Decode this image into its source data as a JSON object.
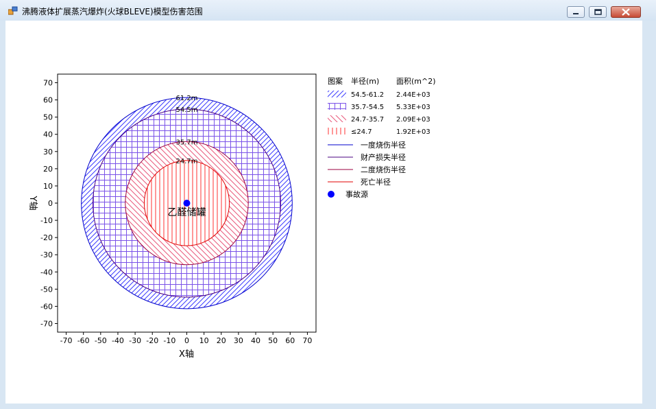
{
  "window": {
    "title": "沸腾液体扩展蒸汽爆炸(火球BLEVE)模型伤害范围",
    "icon": "app-icon",
    "buttons": [
      "minimize-icon",
      "restore-icon",
      "close-icon"
    ]
  },
  "chart_data": {
    "type": "contour-circles",
    "xlabel": "X轴",
    "ylabel": "Y轴",
    "xlim": [
      -75,
      75
    ],
    "ylim": [
      -75,
      75
    ],
    "xticks": [
      -70,
      -60,
      -50,
      -40,
      -30,
      -20,
      -10,
      0,
      10,
      20,
      30,
      40,
      50,
      60,
      70
    ],
    "yticks": [
      70,
      60,
      50,
      40,
      30,
      20,
      10,
      0,
      -10,
      -20,
      -30,
      -40,
      -50,
      -60,
      -70
    ],
    "center": [
      0,
      0
    ],
    "center_label": "乙醛储罐",
    "rings": [
      {
        "radius": 61.2,
        "label": "61.2m",
        "color": "#0000cc",
        "pattern": "diag-blue"
      },
      {
        "radius": 54.5,
        "label": "54.5m",
        "color": "#4b0082",
        "pattern": "grid-purple"
      },
      {
        "radius": 35.7,
        "label": "35.7m",
        "color": "#9b0040",
        "pattern": "diag-red"
      },
      {
        "radius": 24.7,
        "label": "24.7m",
        "color": "#e00000",
        "pattern": "vert-red"
      }
    ],
    "legend": {
      "header": [
        "图案",
        "半径(m)",
        "面积(m^2)"
      ],
      "pattern_rows": [
        {
          "range": "54.5-61.2",
          "area": "2.44E+03",
          "pattern": "diag-blue"
        },
        {
          "range": "35.7-54.5",
          "area": "5.33E+03",
          "pattern": "grid-purple"
        },
        {
          "range": "24.7-35.7",
          "area": "2.09E+03",
          "pattern": "diag-red"
        },
        {
          "range": "≤24.7",
          "area": "1.92E+03",
          "pattern": "vert-red"
        }
      ],
      "line_rows": [
        {
          "label": "一度烧伤半径",
          "color": "#0000cc"
        },
        {
          "label": "财产损失半径",
          "color": "#4b0082"
        },
        {
          "label": "二度烧伤半径",
          "color": "#9b0040"
        },
        {
          "label": "死亡半径",
          "color": "#e00000"
        }
      ],
      "source_label": "事故源",
      "source_color": "#0000ff"
    }
  }
}
